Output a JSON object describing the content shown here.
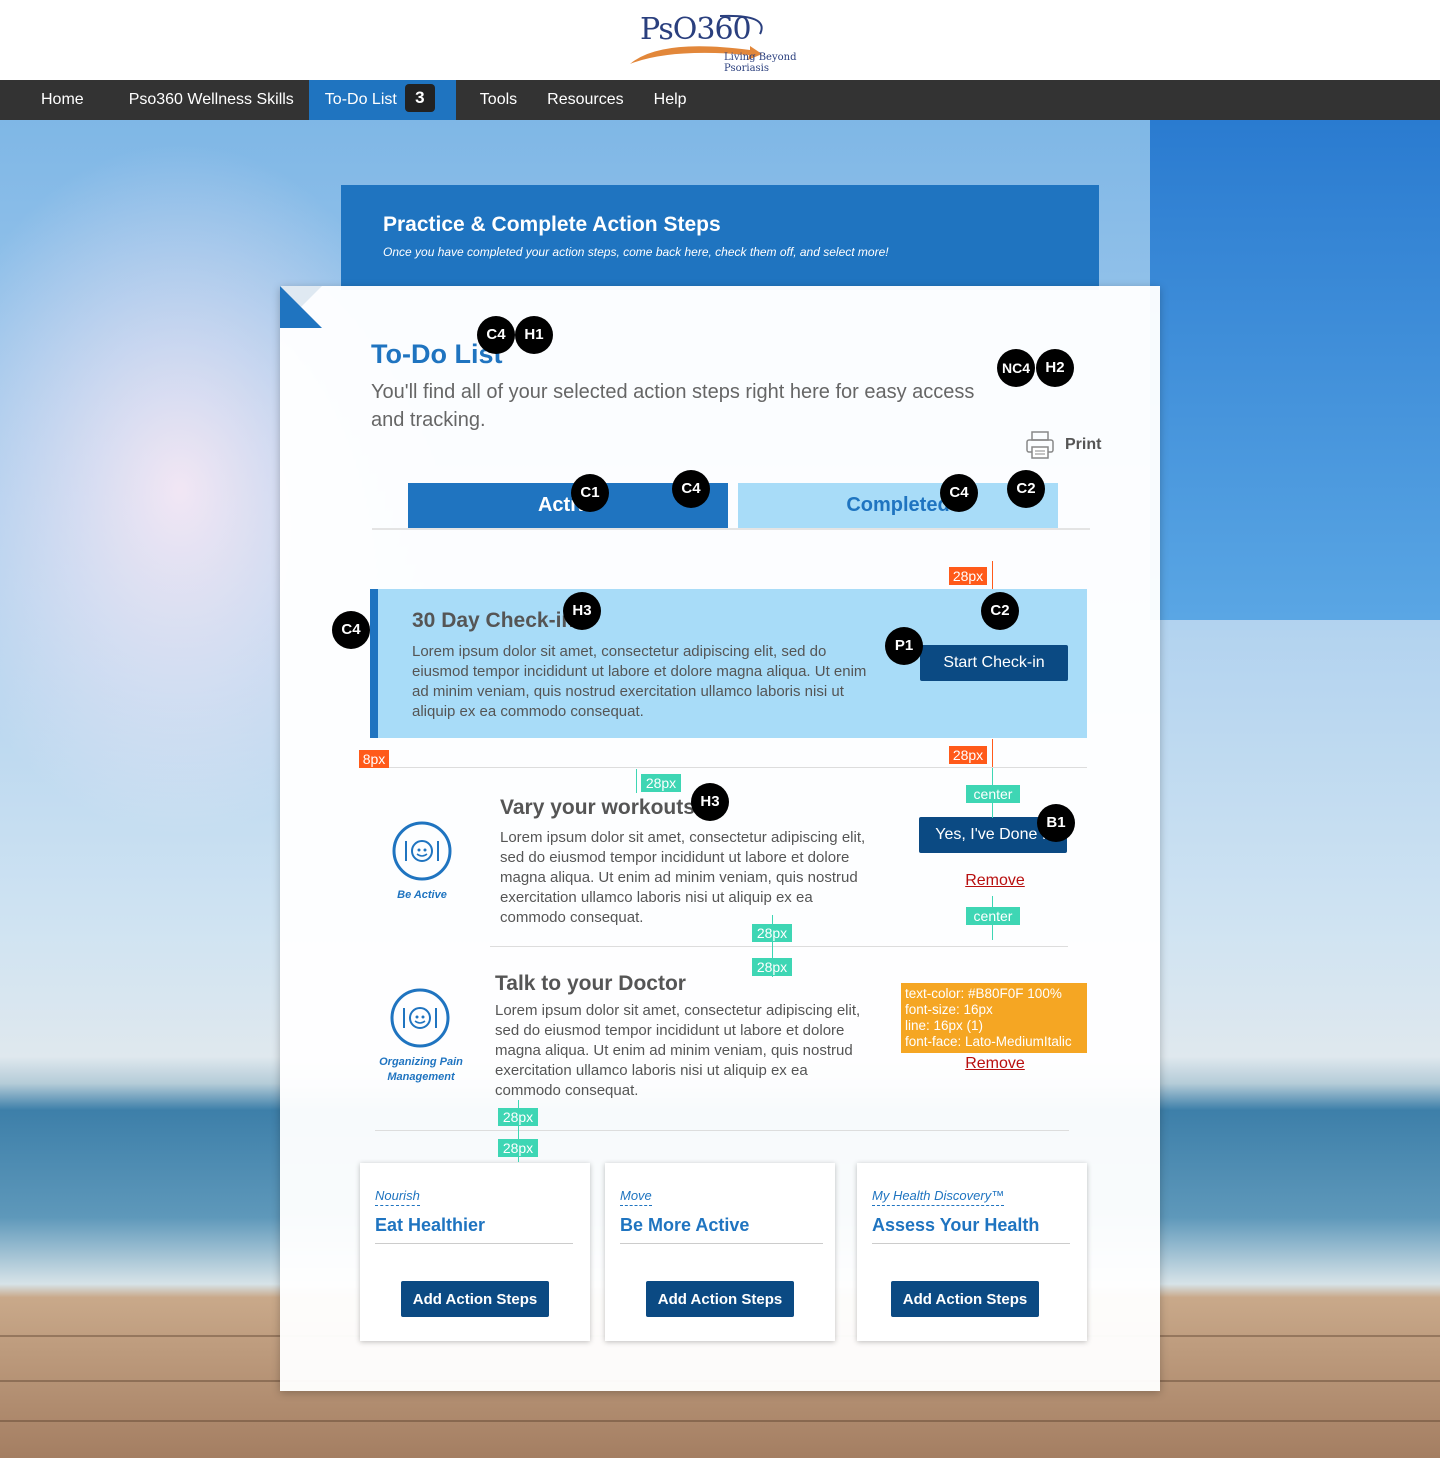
{
  "header": {
    "logo_main": "PsO360",
    "logo_sub": "Living Beyond Psoriasis"
  },
  "nav": {
    "items": [
      "Home",
      "Pso360 Wellness Skills",
      "To-Do List",
      "Tools",
      "Resources",
      "Help"
    ],
    "todo_count": "3"
  },
  "banner": {
    "title": "Practice & Complete Action Steps",
    "subtitle": "Once you have completed your action steps, come back here, check them off, and select more!"
  },
  "todo": {
    "title": "To-Do List",
    "subtitle": "You'll find all of your selected action steps right here for easy access and tracking.",
    "print_label": "Print",
    "tabs": [
      "Active",
      "Completed"
    ]
  },
  "checkin": {
    "title": "30 Day Check-in",
    "body": "Lorem ipsum dolor sit amet, consectetur adipiscing elit, sed do eiusmod tempor incididunt ut labore et dolore magna aliqua. Ut enim ad minim veniam, quis nostrud exercitation ullamco laboris nisi ut aliquip ex ea commodo consequat.",
    "button": "Start Check-in"
  },
  "items": [
    {
      "title": "Vary your workouts",
      "body": "Lorem ipsum dolor sit amet, consectetur adipiscing elit, sed do eiusmod tempor incididunt ut labore et dolore magna aliqua. Ut enim ad minim veniam, quis nostrud exercitation ullamco laboris nisi ut aliquip ex ea commodo consequat.",
      "category": "Be Active",
      "done_button": "Yes, I've Done It",
      "remove": "Remove"
    },
    {
      "title": "Talk to your Doctor",
      "body": "Lorem ipsum dolor sit amet, consectetur adipiscing elit, sed do eiusmod tempor incididunt ut labore et dolore magna aliqua. Ut enim ad minim veniam, quis nostrud exercitation ullamco laboris nisi ut aliquip ex ea commodo consequat.",
      "category": "Organizing Pain Management",
      "remove": "Remove"
    }
  ],
  "add_cards": [
    {
      "category": "Nourish",
      "title": "Eat Healthier",
      "button": "Add Action Steps"
    },
    {
      "category": "Move",
      "title": "Be More Active",
      "button": "Add Action Steps"
    },
    {
      "category": "My Health Discovery™",
      "title": "Assess Your Health",
      "button": "Add Action Steps"
    }
  ],
  "annotations": {
    "markers": [
      "C4",
      "H1",
      "NC4",
      "H2",
      "C1",
      "C4",
      "C4",
      "C2",
      "C2",
      "H3",
      "C4",
      "P1",
      "H3",
      "B1"
    ],
    "spacing": [
      "28px",
      "8px",
      "28px",
      "28px",
      "center",
      "center",
      "28px",
      "28px",
      "28px",
      "28px"
    ],
    "style_note": [
      "text-color: #B80F0F 100%",
      "font-size: 16px",
      "line: 16px (1)",
      "font-face: Lato-MediumItalic"
    ]
  },
  "colors": {
    "brand_blue": "#1f74c0",
    "nav_bg": "#333333",
    "button_navy": "#0b4a83",
    "light_blue": "#a8dcf8",
    "remove_red": "#b80f0f",
    "note_orange": "#f5a623"
  }
}
